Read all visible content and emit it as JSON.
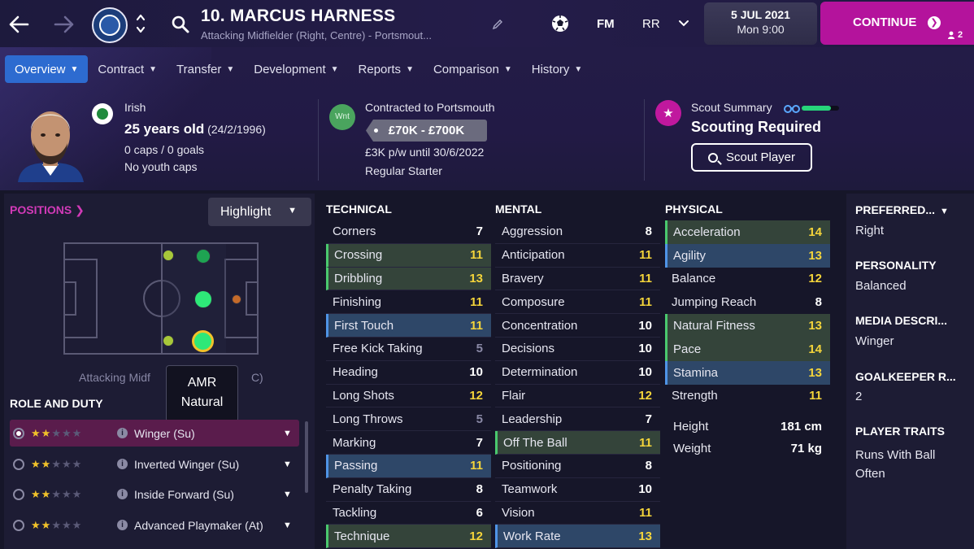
{
  "header": {
    "player_name": "10. MARCUS HARNESS",
    "player_sub": "Attacking Midfielder (Right, Centre) - Portsmout...",
    "fm_label": "FM",
    "initials": "RR",
    "date": "5 JUL 2021",
    "time": "Mon 9:00",
    "continue_label": "CONTINUE",
    "continue_count": "2"
  },
  "tabs": [
    {
      "label": "Overview"
    },
    {
      "label": "Contract"
    },
    {
      "label": "Transfer"
    },
    {
      "label": "Development"
    },
    {
      "label": "Reports"
    },
    {
      "label": "Comparison"
    },
    {
      "label": "History"
    }
  ],
  "profile": {
    "nationality": "Irish",
    "age": "25 years old",
    "dob": "(24/2/1996)",
    "caps": "0 caps / 0 goals",
    "youth_caps": "No youth caps",
    "wnt": "Wnt",
    "contract_status": "Contracted to Portsmouth",
    "value_range": "£70K - £700K",
    "wage": "£3K p/w until 30/6/2022",
    "squad_status": "Regular Starter",
    "scout_title": "Scout Summary",
    "scout_status": "Scouting Required",
    "scout_button": "Scout Player",
    "scout_knowledge_fraction": 0.78
  },
  "positions": {
    "header": "POSITIONS",
    "highlight_label": "Highlight",
    "caption_left": "Attacking Midf",
    "caption_right": "C)",
    "tooltip_line1": "AMR",
    "tooltip_line2": "Natural"
  },
  "roles": {
    "header": "ROLE AND DUTY",
    "items": [
      {
        "label": "Winger (Su)",
        "stars": 1.5,
        "active": true
      },
      {
        "label": "Inverted Winger (Su)",
        "stars": 1.5,
        "active": false
      },
      {
        "label": "Inside Forward (Su)",
        "stars": 1.5,
        "active": false
      },
      {
        "label": "Advanced Playmaker (At)",
        "stars": 1.5,
        "active": false
      }
    ]
  },
  "technical": {
    "header": "TECHNICAL",
    "rows": [
      {
        "name": "Corners",
        "value": "7"
      },
      {
        "name": "Crossing",
        "value": "11"
      },
      {
        "name": "Dribbling",
        "value": "13"
      },
      {
        "name": "Finishing",
        "value": "11"
      },
      {
        "name": "First Touch",
        "value": "11"
      },
      {
        "name": "Free Kick Taking",
        "value": "5"
      },
      {
        "name": "Heading",
        "value": "10"
      },
      {
        "name": "Long Shots",
        "value": "12"
      },
      {
        "name": "Long Throws",
        "value": "5"
      },
      {
        "name": "Marking",
        "value": "7"
      },
      {
        "name": "Passing",
        "value": "11"
      },
      {
        "name": "Penalty Taking",
        "value": "8"
      },
      {
        "name": "Tackling",
        "value": "6"
      },
      {
        "name": "Technique",
        "value": "12"
      }
    ]
  },
  "mental": {
    "header": "MENTAL",
    "rows": [
      {
        "name": "Aggression",
        "value": "8"
      },
      {
        "name": "Anticipation",
        "value": "11"
      },
      {
        "name": "Bravery",
        "value": "11"
      },
      {
        "name": "Composure",
        "value": "11"
      },
      {
        "name": "Concentration",
        "value": "10"
      },
      {
        "name": "Decisions",
        "value": "10"
      },
      {
        "name": "Determination",
        "value": "10"
      },
      {
        "name": "Flair",
        "value": "12"
      },
      {
        "name": "Leadership",
        "value": "7"
      },
      {
        "name": "Off The Ball",
        "value": "11"
      },
      {
        "name": "Positioning",
        "value": "8"
      },
      {
        "name": "Teamwork",
        "value": "10"
      },
      {
        "name": "Vision",
        "value": "11"
      },
      {
        "name": "Work Rate",
        "value": "13"
      }
    ]
  },
  "physical": {
    "header": "PHYSICAL",
    "rows": [
      {
        "name": "Acceleration",
        "value": "14"
      },
      {
        "name": "Agility",
        "value": "13"
      },
      {
        "name": "Balance",
        "value": "12"
      },
      {
        "name": "Jumping Reach",
        "value": "8"
      },
      {
        "name": "Natural Fitness",
        "value": "13"
      },
      {
        "name": "Pace",
        "value": "14"
      },
      {
        "name": "Stamina",
        "value": "13"
      },
      {
        "name": "Strength",
        "value": "11"
      }
    ],
    "height_label": "Height",
    "height_value": "181 cm",
    "weight_label": "Weight",
    "weight_value": "71 kg"
  },
  "side": {
    "preferred_header": "PREFERRED...",
    "preferred_value": "Right",
    "personality_header": "PERSONALITY",
    "personality_value": "Balanced",
    "media_header": "MEDIA DESCRI...",
    "media_value": "Winger",
    "gk_header": "GOALKEEPER R...",
    "gk_value": "2",
    "traits_header": "PLAYER TRAITS",
    "traits_value_line1": "Runs With Ball",
    "traits_value_line2": "Often"
  },
  "colors": {
    "accent_magenta": "#b4139c",
    "tab_active": "#2d6bd0",
    "highlight_green": "#4ac86e",
    "highlight_blue": "#4f94e6",
    "attr_yellow": "#f4d43a"
  }
}
